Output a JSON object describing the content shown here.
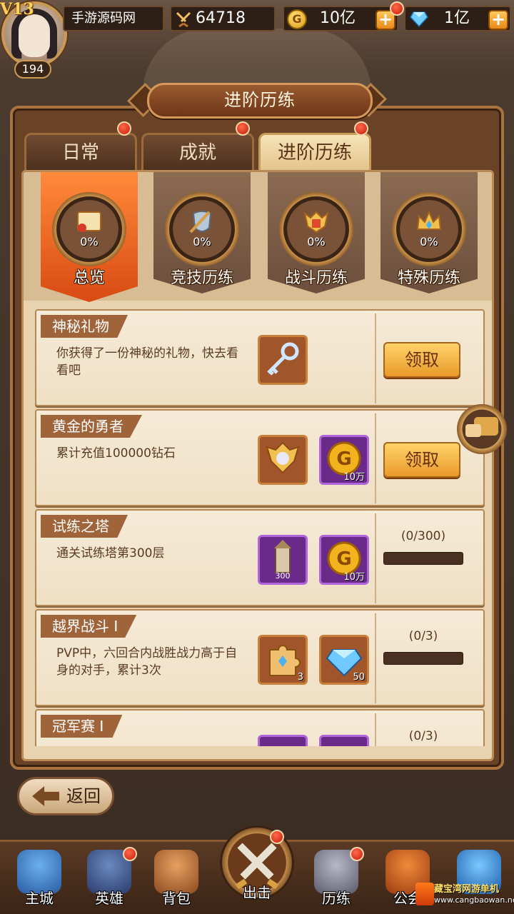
{
  "player": {
    "vip": "V13",
    "level": "194",
    "name": "手游源码网",
    "power": "64718",
    "gold": "10亿",
    "diamonds": "1亿"
  },
  "window": {
    "title": "进阶历练"
  },
  "tabs": [
    {
      "label": "日常"
    },
    {
      "label": "成就"
    },
    {
      "label": "进阶历练"
    }
  ],
  "categories": [
    {
      "label": "总览",
      "pct": "0%"
    },
    {
      "label": "竞技历练",
      "pct": "0%"
    },
    {
      "label": "战斗历练",
      "pct": "0%"
    },
    {
      "label": "特殊历练",
      "pct": "0%"
    }
  ],
  "tasks": [
    {
      "title": "神秘礼物",
      "desc": "你获得了一份神秘的礼物，快去看看吧",
      "action": "领取"
    },
    {
      "title": "黄金的勇者",
      "desc": "累计充值100000钻石",
      "reward2_qty": "10万",
      "action": "领取"
    },
    {
      "title": "试练之塔",
      "desc": "通关试练塔第300层",
      "reward1_text": "300",
      "reward2_qty": "10万",
      "progress": "(0/300)",
      "progress_value": 0
    },
    {
      "title": "越界战斗 I",
      "desc": "PVP中，六回合内战胜战力高于自身的对手，累计3次",
      "reward1_qty": "3",
      "reward2_qty": "50",
      "progress": "(0/3)",
      "progress_value": 0
    },
    {
      "title": "冠军赛 I",
      "progress": "(0/3)",
      "progress_value": 0
    }
  ],
  "back_label": "返回",
  "nav": [
    {
      "label": "主城"
    },
    {
      "label": "英雄"
    },
    {
      "label": "背包"
    },
    {
      "label": "出击"
    },
    {
      "label": "历练"
    },
    {
      "label": "公会"
    }
  ],
  "watermark": {
    "text": "藏宝湾网游单机",
    "url": "www.cangbaowan.net"
  },
  "colors": {
    "accent": "#e9782a",
    "panel": "#6a4226",
    "card": "#f6ebd8",
    "claim": "#ffd36a"
  }
}
